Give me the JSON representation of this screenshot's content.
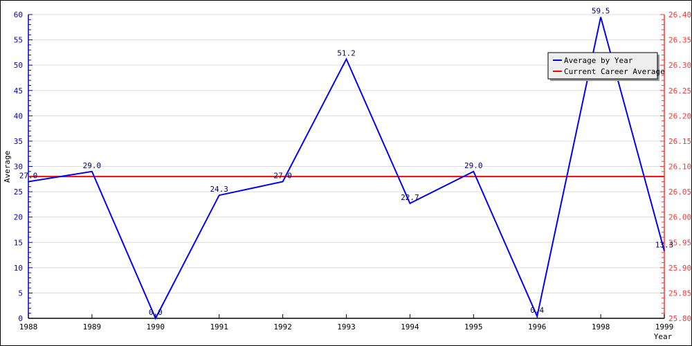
{
  "chart_data": {
    "type": "line",
    "title": "",
    "xlabel": "Year",
    "ylabel": "Average",
    "x": [
      "1988",
      "1989",
      "1990",
      "1991",
      "1992",
      "1993",
      "1994",
      "1995",
      "1996",
      "1998",
      "1999"
    ],
    "x_positions": [
      1988,
      1989,
      1990,
      1991,
      1992,
      1993,
      1994,
      1995,
      1996,
      1998,
      1999
    ],
    "x_axis_categorical": true,
    "series": [
      {
        "name": "Average by Year",
        "color": "#0000ff",
        "axis": "left",
        "values": [
          27.0,
          29.0,
          0.0,
          24.3,
          27.0,
          51.2,
          22.7,
          29.0,
          0.4,
          59.5,
          13.3
        ],
        "labels": [
          "27.0",
          "29.0",
          "0.0",
          "24.3",
          "27.0",
          "51.2",
          "22.7",
          "29.0",
          "0.4",
          "59.5",
          "13.3"
        ]
      },
      {
        "name": "Current Career Average",
        "color": "#ff0000",
        "axis": "right",
        "value": 26.08
      }
    ],
    "ylim": [
      0,
      60
    ],
    "yticks": [
      "0",
      "5",
      "10",
      "15",
      "20",
      "25",
      "30",
      "35",
      "40",
      "45",
      "50",
      "55",
      "60"
    ],
    "y2lim": [
      25.8,
      26.4
    ],
    "y2ticks": [
      "25.80",
      "25.85",
      "25.90",
      "25.95",
      "26.00",
      "26.05",
      "26.10",
      "26.15",
      "26.20",
      "26.25",
      "26.30",
      "26.35",
      "26.40"
    ],
    "grid": true,
    "legend": "top-right"
  }
}
